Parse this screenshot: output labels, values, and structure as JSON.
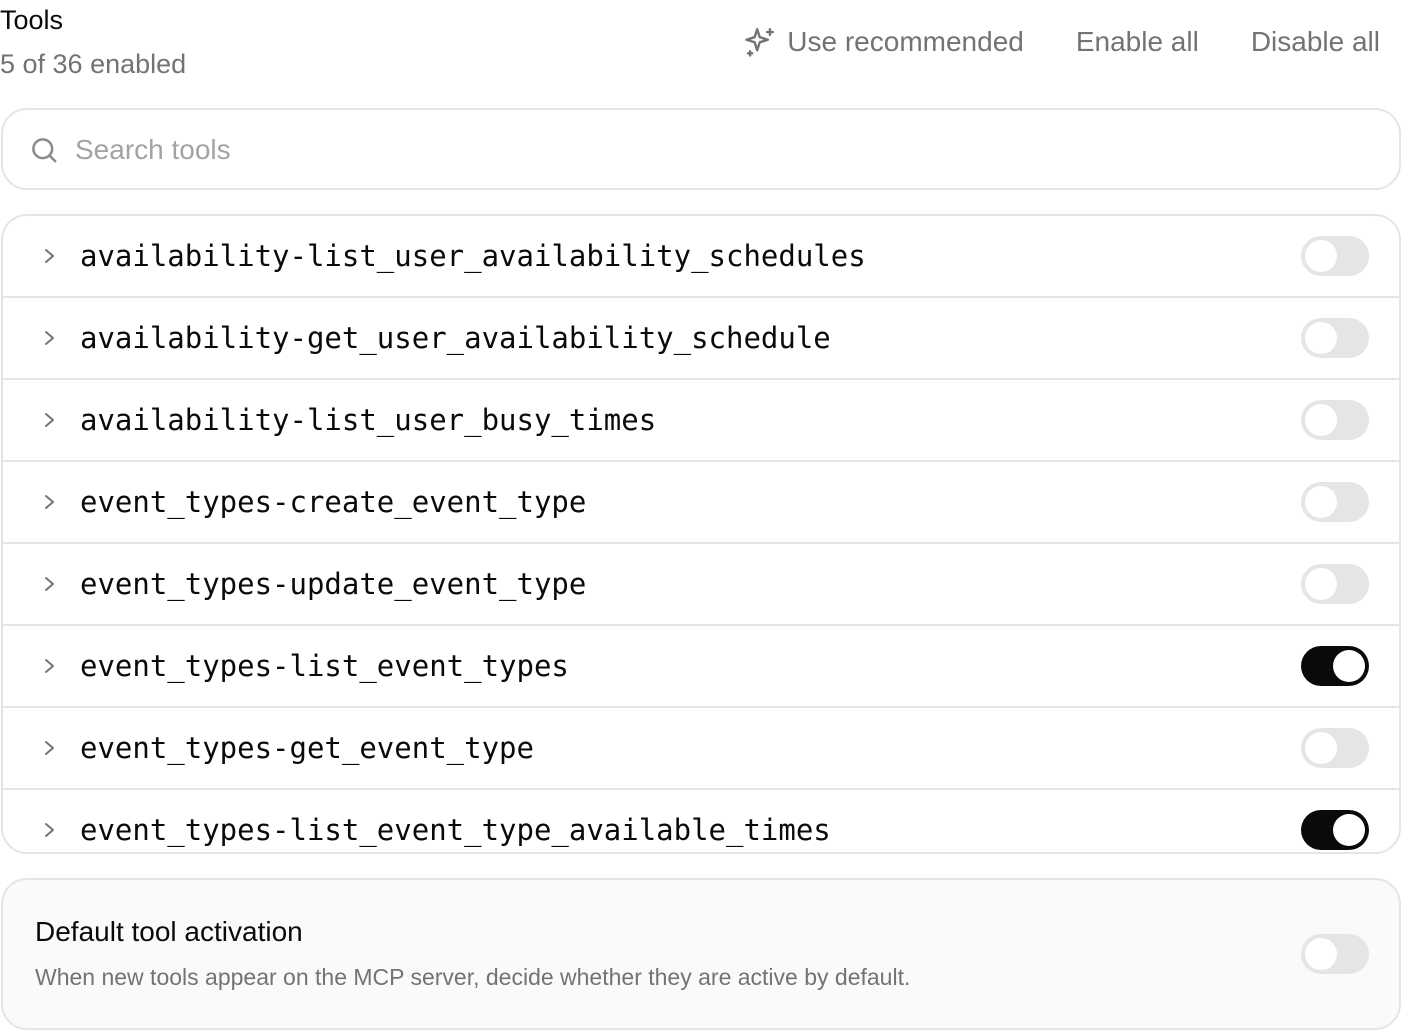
{
  "header": {
    "title": "Tools",
    "subtitle": "5 of 36 enabled",
    "use_recommended": "Use recommended",
    "enable_all": "Enable all",
    "disable_all": "Disable all"
  },
  "search": {
    "placeholder": "Search tools",
    "value": ""
  },
  "tools": [
    {
      "name": "availability-list_user_availability_schedules",
      "enabled": false
    },
    {
      "name": "availability-get_user_availability_schedule",
      "enabled": false
    },
    {
      "name": "availability-list_user_busy_times",
      "enabled": false
    },
    {
      "name": "event_types-create_event_type",
      "enabled": false
    },
    {
      "name": "event_types-update_event_type",
      "enabled": false
    },
    {
      "name": "event_types-list_event_types",
      "enabled": true
    },
    {
      "name": "event_types-get_event_type",
      "enabled": false
    },
    {
      "name": "event_types-list_event_type_available_times",
      "enabled": true
    }
  ],
  "default_activation": {
    "title": "Default tool activation",
    "description": "When new tools appear on the MCP server, decide whether they are active by default.",
    "enabled": false
  },
  "icons": {
    "use_recommended": "sparkles-icon",
    "search": "search-icon",
    "expand": "chevron-right-icon"
  },
  "colors": {
    "toggle_on": "#0a0a0a",
    "toggle_off": "#e5e5e5",
    "muted_text": "#737373",
    "border": "#e5e5e5"
  }
}
